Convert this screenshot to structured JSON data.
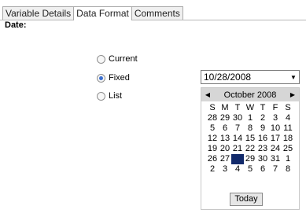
{
  "tabs": [
    {
      "label": "Variable Details",
      "active": false
    },
    {
      "label": "Data Format",
      "active": true
    },
    {
      "label": "Comments",
      "active": false
    }
  ],
  "section_label": "Date:",
  "options": [
    {
      "label": "Current",
      "checked": false
    },
    {
      "label": "Fixed",
      "checked": true
    },
    {
      "label": "List",
      "checked": false
    }
  ],
  "date_value": "10/28/2008",
  "calendar": {
    "month_label": "October 2008",
    "weekday_headers": [
      "S",
      "M",
      "T",
      "W",
      "T",
      "F",
      "S"
    ],
    "weeks": [
      [
        "28",
        "29",
        "30",
        "1",
        "2",
        "3",
        "4"
      ],
      [
        "5",
        "6",
        "7",
        "8",
        "9",
        "10",
        "11"
      ],
      [
        "12",
        "13",
        "14",
        "15",
        "16",
        "17",
        "18"
      ],
      [
        "19",
        "20",
        "21",
        "22",
        "23",
        "24",
        "25"
      ],
      [
        "26",
        "27",
        "28",
        "29",
        "30",
        "31",
        "1"
      ],
      [
        "2",
        "3",
        "4",
        "5",
        "6",
        "7",
        "8"
      ]
    ],
    "selected_day": "28",
    "today_label": "Today"
  },
  "colors": {
    "selection": "#122a6b",
    "header": "#d6d6d6"
  },
  "icons": {
    "nav_prev": "triangle-left-icon",
    "nav_next": "triangle-right-icon",
    "dropdown": "triangle-down-icon"
  }
}
